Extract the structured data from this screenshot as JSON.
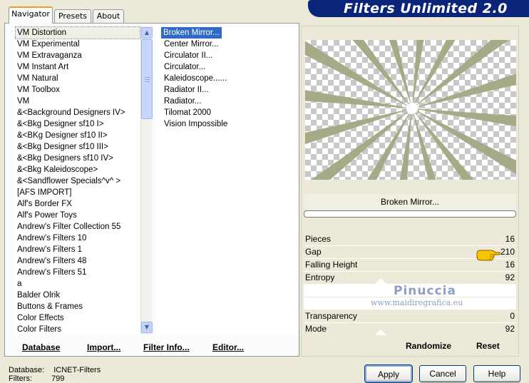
{
  "tabs": [
    {
      "label": "Navigator",
      "active": true
    },
    {
      "label": "Presets",
      "active": false
    },
    {
      "label": "About",
      "active": false
    }
  ],
  "title": "Filters Unlimited 2.0",
  "categories": {
    "selected_index": 0,
    "items": [
      "VM Distortion",
      "VM Experimental",
      "VM Extravaganza",
      "VM Instant Art",
      "VM Natural",
      "VM Toolbox",
      "VM",
      "&<Background Designers IV>",
      "&<Bkg Designer sf10 I>",
      "&<BKg Designer sf10 II>",
      "&<Bkg Designer sf10 III>",
      "&<Bkg Designers sf10 IV>",
      "&<Bkg Kaleidoscope>",
      "&<Sandflower Specials^v^ >",
      "[AFS IMPORT]",
      "Alf's Border FX",
      "Alf's Power Toys",
      "Andrew's Filter Collection 55",
      "Andrew's Filters 10",
      "Andrew's Filters 1",
      "Andrew's Filters 48",
      "Andrew's Filters 51",
      "a",
      "Balder Olrik",
      "Buttons & Frames",
      "Color Effects",
      "Color Filters"
    ]
  },
  "filters": {
    "selected_index": 0,
    "items": [
      "Broken Mirror...",
      "Center Mirror...",
      "Circulator II...",
      "Circulator...",
      "Kaleidoscope......",
      "Radiator II...",
      "Radiator...",
      "Tilomat 2000",
      "Vision Impossible"
    ]
  },
  "bottom_buttons": {
    "database": "Database",
    "import": "Import...",
    "filter_info": "Filter Info...",
    "editor": "Editor..."
  },
  "preview": {
    "filter_name": "Broken Mirror...",
    "ray_color": "#a4ab86",
    "progress": 0
  },
  "params": [
    {
      "label": "Pieces",
      "value": "16"
    },
    {
      "label": "Gap",
      "value": "210"
    },
    {
      "label": "Falling Height",
      "value": "16"
    },
    {
      "label": "Entropy",
      "value": "92"
    },
    {
      "label": "Transparency",
      "value": "0"
    },
    {
      "label": "Mode",
      "value": "92"
    }
  ],
  "actions": {
    "randomize": "Randomize",
    "reset": "Reset"
  },
  "watermark": {
    "name": "Pinuccia",
    "site": "www.maidiregrafica.eu"
  },
  "status": {
    "database_label": "Database:",
    "database_value": "ICNET-Filters",
    "filters_label": "Filters:",
    "filters_value": "799"
  },
  "dialog_buttons": {
    "apply": "Apply",
    "cancel": "Cancel",
    "help": "Help"
  },
  "colors": {
    "title_banner": "#0a2479",
    "selection": "#316ac5"
  }
}
